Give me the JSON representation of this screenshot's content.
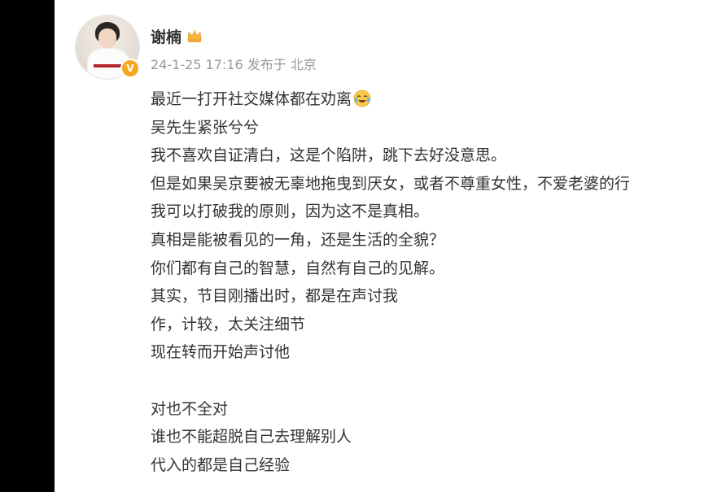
{
  "post": {
    "username": "谢楠",
    "timestamp": "24-1-25 17:16",
    "location": "发布于 北京",
    "lines": [
      "最近一打开社交媒体都在劝离",
      "吴先生紧张兮兮",
      "我不喜欢自证清白，这是个陷阱，跳下去好没意思。",
      "但是如果吴京要被无辜地拖曳到厌女，或者不尊重女性，不爱老婆的行",
      "我可以打破我的原则，因为这不是真相。",
      "真相是能被看见的一角，还是生活的全貌？",
      "你们都有自己的智慧，自然有自己的见解。",
      "其实，节目刚播出时，都是在声讨我",
      "作，计较，太关注细节",
      "现在转而开始声讨他",
      "",
      "对也不全对",
      "谁也不能超脱自己去理解别人",
      "代入的都是自己经验"
    ]
  },
  "icons": {
    "verified": "verified-badge-icon",
    "crown": "crown-icon",
    "emoji": "laugh-cry-emoji-icon"
  },
  "colors": {
    "username": "#333333",
    "meta": "#999999",
    "text": "#333333",
    "badge": "#f6a623",
    "background": "#ffffff",
    "frame": "#000000"
  }
}
